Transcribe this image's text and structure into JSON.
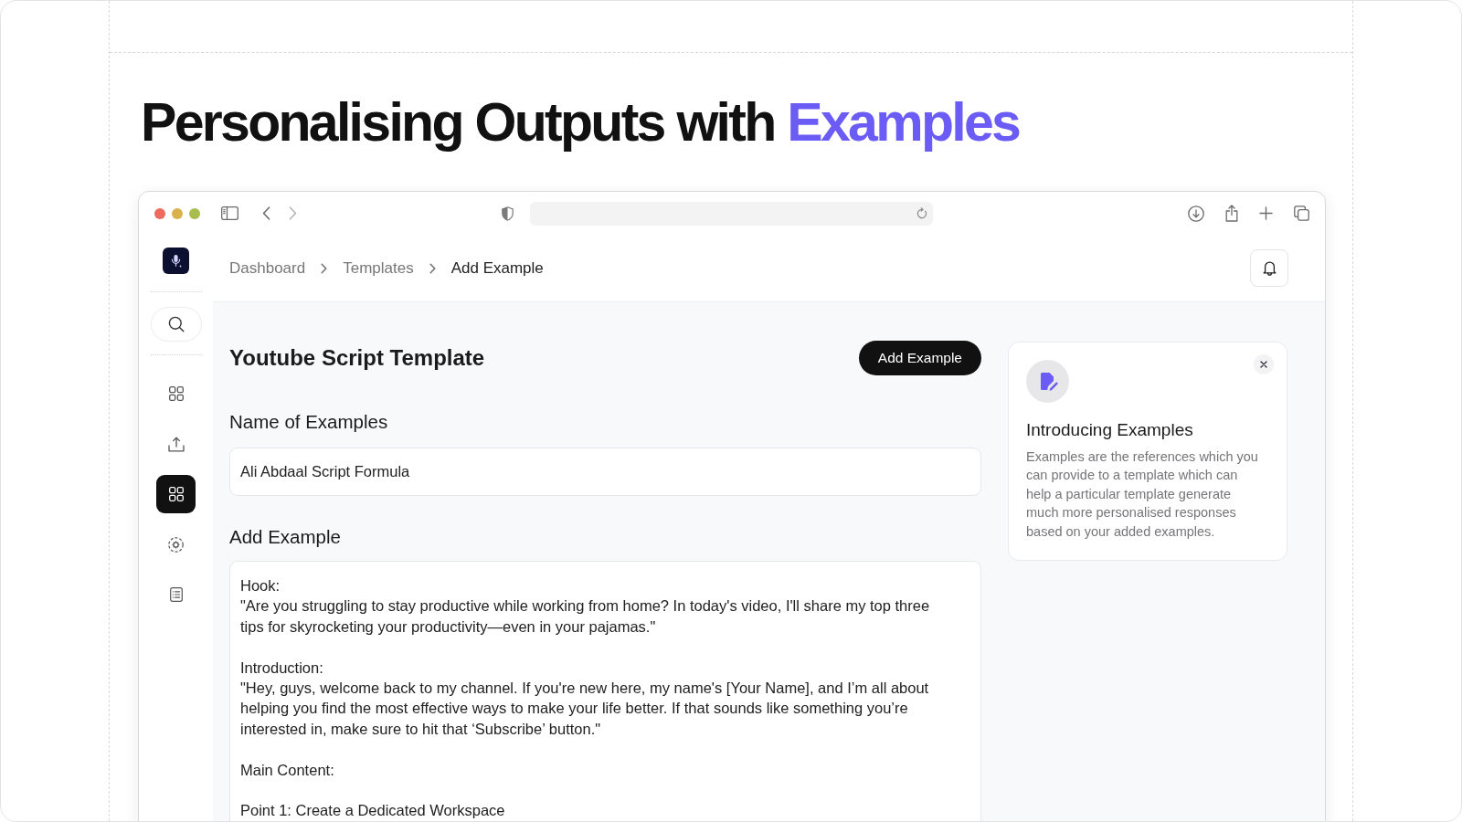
{
  "headline": {
    "text": "Personalising Outputs with",
    "highlight": "Examples"
  },
  "sidebar": {
    "items": [
      {
        "selected": false
      },
      {
        "selected": false
      },
      {
        "selected": true
      },
      {
        "selected": false
      },
      {
        "selected": false
      }
    ]
  },
  "breadcrumbs": [
    {
      "label": "Dashboard",
      "current": false
    },
    {
      "label": "Templates",
      "current": false
    },
    {
      "label": "Add Example",
      "current": true
    }
  ],
  "page": {
    "title": "Youtube Script Template",
    "primary_button": "Add Example",
    "name_field": {
      "label": "Name of Examples",
      "value": "Ali Abdaal Script Formula"
    },
    "example_field": {
      "label": "Add Example",
      "paragraphs": [
        [
          "Hook:",
          "\"Are you struggling to stay productive while working from home? In today's video, I'll share my top three tips for skyrocketing your productivity—even in your pajamas.\""
        ],
        [
          "Introduction:",
          "\"Hey, guys, welcome back to my channel. If you're new here, my name's [Your Name], and I’m all about helping you find the most effective ways to make your life better. If that sounds like something you’re interested in, make sure to hit that ‘Subscribe’ button.\""
        ],
        [
          "Main Content:"
        ],
        [
          "Point 1: Create a Dedicated Workspace"
        ]
      ]
    }
  },
  "info_card": {
    "title": "Introducing Examples",
    "description": "Examples are the references which you can provide to a template which can help a particular template generate much more personalised responses based on your added examples."
  }
}
